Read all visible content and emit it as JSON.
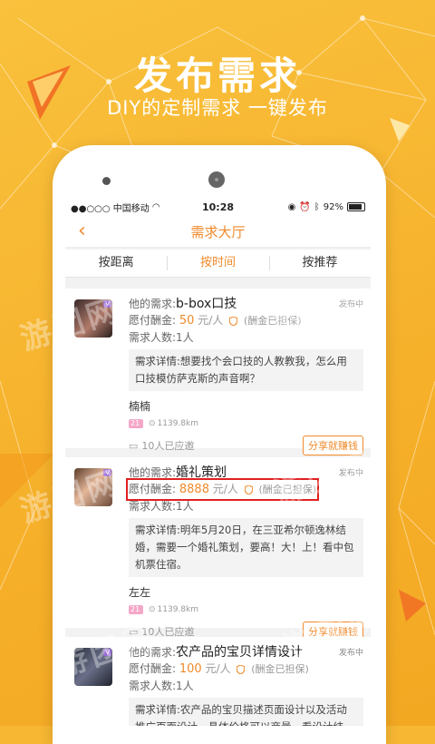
{
  "hero": {
    "title": "发布需求",
    "subtitle": "DIY的定制需求  一键发布"
  },
  "status_bar": {
    "carrier": "●●○○○ 中国移动",
    "time": "10:28",
    "battery": "92%"
  },
  "header": {
    "title": "需求大厅"
  },
  "tabs": [
    {
      "label": "按距离"
    },
    {
      "label": "按时间"
    },
    {
      "label": "按推荐"
    }
  ],
  "watermark": "游团网",
  "cards": [
    {
      "need_label": "他的需求:",
      "title": "b-box口技",
      "status": "发布中",
      "reward_label": "愿付酬金:",
      "amount": "50",
      "unit": "元/人",
      "guarantee": "(酬金已担保)",
      "people_label": "需求人数:",
      "people": "1人",
      "detail": "需求详情:想要找个会口技的人教教我，怎么用口技模仿萨克斯的声音啊？",
      "name": "楠楠",
      "age": "21",
      "distance": "1139.8km",
      "invited": "10人已应邀",
      "share": "分享就赚钱"
    },
    {
      "need_label": "他的需求:",
      "title": "婚礼策划",
      "status": "发布中",
      "reward_label": "愿付酬金:",
      "amount": "8888",
      "unit": "元/人",
      "guarantee": "(酬金已担保)",
      "people_label": "需求人数:",
      "people": "1人",
      "detail": "需求详情:明年5月20日，在三亚希尔顿逸林结婚，需要一个婚礼策划，要高！大！上！看中包机票住宿。",
      "name": "左左",
      "age": "21",
      "distance": "1139.8km",
      "invited": "10人已应邀",
      "share": "分享就赚钱"
    },
    {
      "need_label": "他的需求:",
      "title": "农产品的宝贝详情设计",
      "status": "发布中",
      "reward_label": "愿付酬金:",
      "amount": "100",
      "unit": "元/人",
      "guarantee": "(酬金已担保)",
      "people_label": "需求人数:",
      "people": "1人",
      "detail": "需求详情:农产品的宝贝描述页面设计以及活动推广页面设计，具体价格可以商量，看设计结"
    }
  ],
  "colors": {
    "background": "#f7b733",
    "accent": "#f08a2b",
    "highlight_box": "#e02020"
  }
}
